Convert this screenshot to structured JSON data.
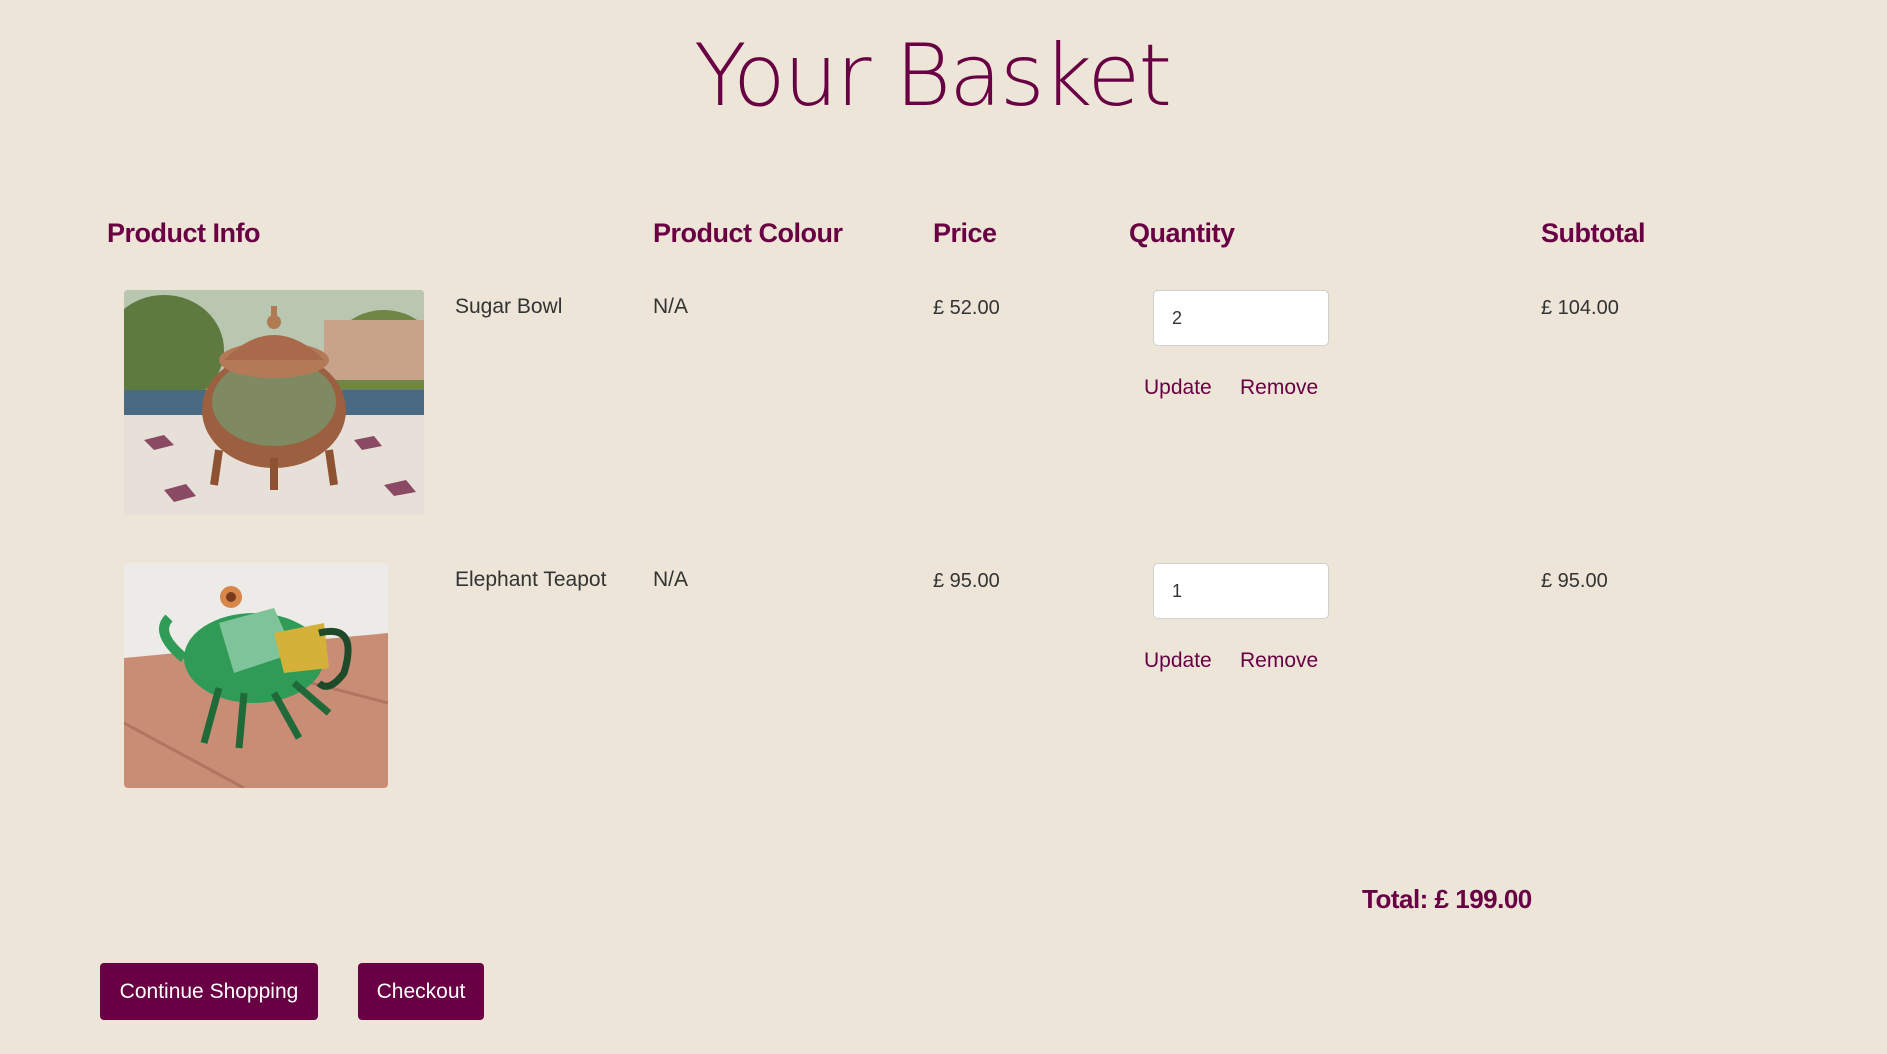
{
  "page": {
    "title": "Your Basket"
  },
  "table": {
    "headers": {
      "product_info": "Product Info",
      "product_colour": "Product Colour",
      "price": "Price",
      "quantity": "Quantity",
      "subtotal": "Subtotal"
    },
    "rows": [
      {
        "name": "Sugar Bowl",
        "colour": "N/A",
        "price": "£ 52.00",
        "quantity": "2",
        "subtotal": "£ 104.00",
        "update_label": "Update",
        "remove_label": "Remove",
        "image_icon": "sugar-bowl-image"
      },
      {
        "name": "Elephant Teapot",
        "colour": "N/A",
        "price": "£ 95.00",
        "quantity": "1",
        "subtotal": "£ 95.00",
        "update_label": "Update",
        "remove_label": "Remove",
        "image_icon": "elephant-teapot-image"
      }
    ]
  },
  "summary": {
    "total": "Total: £ 199.00"
  },
  "actions": {
    "continue_label": "Continue Shopping",
    "checkout_label": "Checkout"
  },
  "colors": {
    "background": "#ece5d8",
    "brand": "#690043",
    "text": "#333333"
  }
}
